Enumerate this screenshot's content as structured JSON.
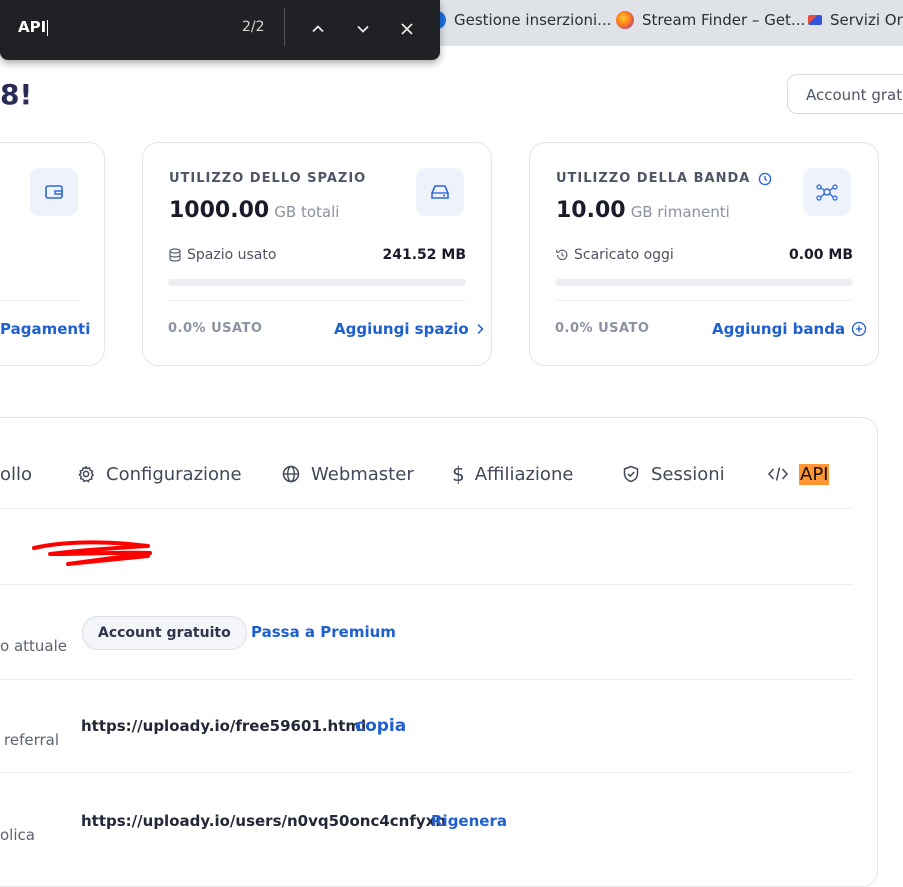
{
  "browser": {
    "tabs": [
      {
        "label": "Gestione inserzioni...",
        "icon": "ads-favicon"
      },
      {
        "label": "Stream Finder – Get...",
        "icon": "firefox-favicon"
      },
      {
        "label": "Servizi Onl",
        "icon": "service-favicon"
      }
    ]
  },
  "find_bar": {
    "query": "API",
    "count": "2/2"
  },
  "header": {
    "greeting_fragment": "8!",
    "account_button": "Account grat"
  },
  "cards": {
    "wallet": {
      "link": "Pagamenti"
    },
    "storage": {
      "title": "UTILIZZO DELLO SPAZIO",
      "amount": "1000.00",
      "unit": "GB totali",
      "row_label": "Spazio usato",
      "row_value": "241.52 MB",
      "progress": 0.0,
      "used": "0.0% USATO",
      "link": "Aggiungi spazio"
    },
    "bandwidth": {
      "title": "UTILIZZO DELLA BANDA",
      "amount": "10.00",
      "unit": "GB rimanenti",
      "row_label": "Scaricato oggi",
      "row_value": "0.00 MB",
      "progress": 0.0,
      "used": "0.0% USATO",
      "link": "Aggiungi banda"
    }
  },
  "nav": {
    "tabs": [
      {
        "label": "ollo"
      },
      {
        "label": "Configurazione",
        "icon": "gear-icon"
      },
      {
        "label": "Webmaster",
        "icon": "globe-icon"
      },
      {
        "label": "Affiliazione",
        "icon": "dollar-icon"
      },
      {
        "label": "Sessioni",
        "icon": "shield-icon"
      },
      {
        "label": "API",
        "icon": "code-icon"
      }
    ]
  },
  "account": {
    "plan_label": "o attuale",
    "plan_badge": "Account gratuito",
    "upgrade_link": "Passa a Premium",
    "referral_label": "referral",
    "referral_url": "https://uploady.io/free59601.html",
    "copy_link": "copia",
    "public_label": "olica",
    "public_url": "https://uploady.io/users/n0vq50onc4cnfyxn",
    "regen_link": "Rigenera"
  },
  "colors": {
    "accent": "#1f5fcf",
    "highlight": "#ff9632",
    "redaction": "#ff0000"
  }
}
